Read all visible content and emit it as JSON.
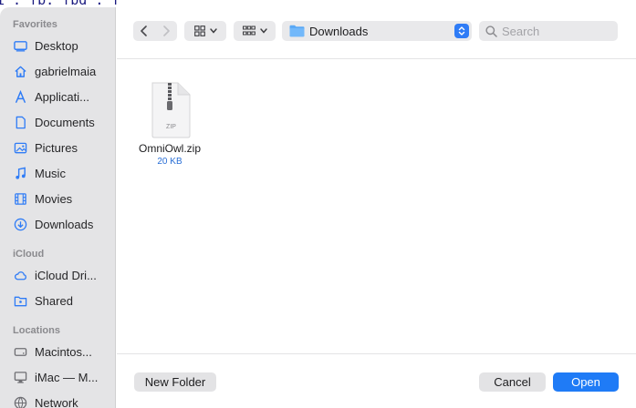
{
  "background_text": {
    "line1": "i : fb. fbd : from  /attr/color"
  },
  "sidebar": {
    "sections": [
      {
        "title": "Favorites",
        "items": [
          {
            "label": "Desktop",
            "icon": "desktop-icon"
          },
          {
            "label": "gabrielmaia",
            "icon": "home-icon"
          },
          {
            "label": "Applicati...",
            "icon": "applications-icon"
          },
          {
            "label": "Documents",
            "icon": "document-icon"
          },
          {
            "label": "Pictures",
            "icon": "pictures-icon"
          },
          {
            "label": "Music",
            "icon": "music-icon"
          },
          {
            "label": "Movies",
            "icon": "movies-icon"
          },
          {
            "label": "Downloads",
            "icon": "downloads-icon"
          }
        ]
      },
      {
        "title": "iCloud",
        "items": [
          {
            "label": "iCloud Dri...",
            "icon": "icloud-icon"
          },
          {
            "label": "Shared",
            "icon": "shared-folder-icon"
          }
        ]
      },
      {
        "title": "Locations",
        "items": [
          {
            "label": "Macintos...",
            "icon": "disk-icon"
          },
          {
            "label": "iMac — M...",
            "icon": "imac-icon"
          },
          {
            "label": "Network",
            "icon": "network-icon"
          }
        ]
      }
    ]
  },
  "toolbar": {
    "location": "Downloads",
    "search_placeholder": "Search"
  },
  "files": [
    {
      "name": "OmniOwl.zip",
      "size": "20 KB",
      "badge": "ZIP"
    }
  ],
  "footer": {
    "new_folder": "New Folder",
    "cancel": "Cancel",
    "open": "Open"
  },
  "colors": {
    "sidebar_icon": "#2f7cf6",
    "accent": "#1f7bf6",
    "sidebar_bg": "#e4e4e6"
  }
}
